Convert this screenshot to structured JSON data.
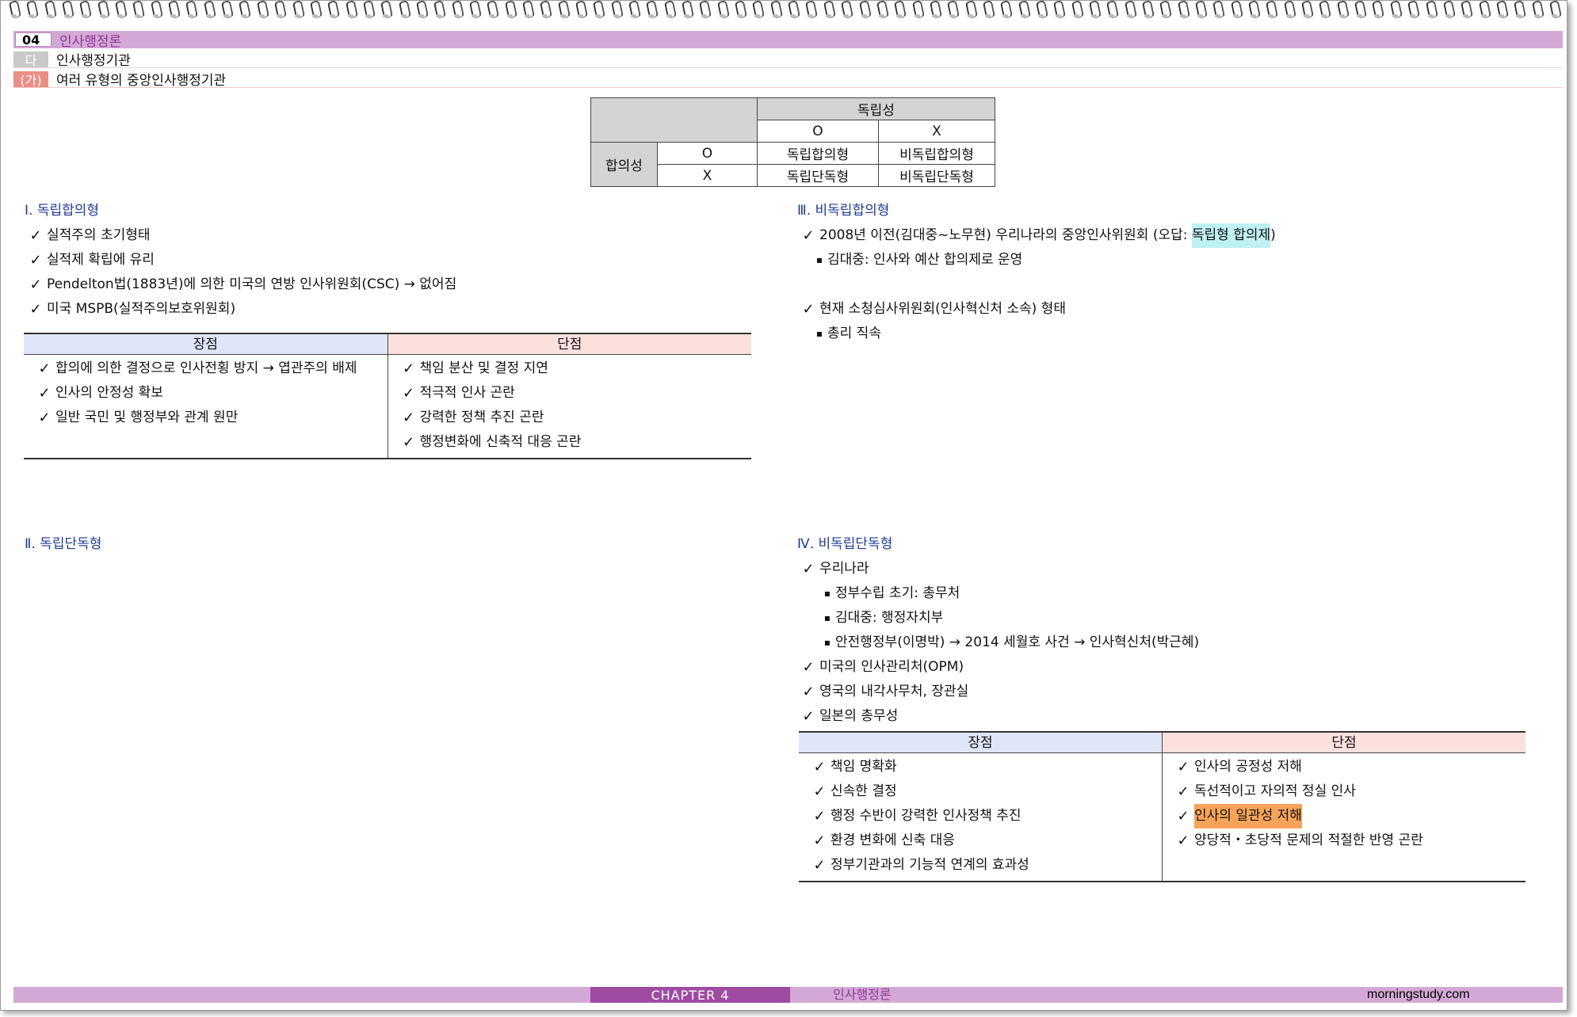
{
  "header": {
    "chapter_num": "04",
    "chapter_title": "인사행정론",
    "section_tag": "다",
    "section_title": "인사행정기관",
    "subsection_tag": "(가)",
    "subsection_title": "여러 유형의 중앙인사행정기관"
  },
  "matrix": {
    "col_group": "독립성",
    "col_o": "O",
    "col_x": "X",
    "row_group": "합의성",
    "row_o": "O",
    "row_x": "X",
    "cell_oo": "독립합의형",
    "cell_ox": "비독립합의형",
    "cell_xo": "독립단독형",
    "cell_xx": "비독립단독형"
  },
  "sec1": {
    "title": "Ⅰ. 독립합의형",
    "items": [
      "실적주의 초기형태",
      "실적제 확립에 유리",
      "Pendelton법(1883년)에 의한 미국의 연방 인사위원회(CSC)  → 없어짐",
      "미국 MSPB(실적주의보호위원회)"
    ],
    "pros_header": "장점",
    "cons_header": "단점",
    "pros": [
      "합의에 의한 결정으로 인사전횡 방지 → 엽관주의 배제",
      "인사의 안정성 확보",
      "일반 국민 및 행정부와 관계 원만"
    ],
    "cons": [
      "책임 분산 및 결정 지연",
      "적극적 인사 곤란",
      "강력한 정책 추진 곤란",
      "행정변화에 신축적 대응 곤란"
    ]
  },
  "sec2": {
    "title": "Ⅱ. 독립단독형"
  },
  "sec3": {
    "title": "Ⅲ. 비독립합의형",
    "item1_pre": "2008년 이전(김대중~노무현) 우리나라의 중앙인사위원회 (오답: ",
    "item1_hl": "독립형 합의제",
    "item1_post": ")",
    "item1_sub": "김대중: 인사와 예산 합의제로 운영",
    "item2": "현재 소청심사위원회(인사혁신처 소속) 형태",
    "item2_sub": "총리 직속"
  },
  "sec4": {
    "title": "Ⅳ. 비독립단독형",
    "item1": "우리나라",
    "item1_subs": [
      "정부수립 초기: 총무처",
      "김대중: 행정자치부",
      "안전행정부(이명박) → 2014 세월호 사건 → 인사혁신처(박근혜)"
    ],
    "item2": "미국의 인사관리처(OPM)",
    "item3": "영국의 내각사무처, 장관실",
    "item4": "일본의 총무성",
    "pros_header": "장점",
    "cons_header": "단점",
    "pros": [
      "책임 명확화",
      "신속한 결정",
      "행정 수반이 강력한 인사정책 추진",
      "환경 변화에 신축 대응",
      "정부기관과의 기능적 연계의 효과성"
    ],
    "cons": [
      "인사의 공정성 저해",
      "독선적이고 자의적 정실 인사",
      "인사의 일관성 저해",
      "양당적・초당적 문제의 적절한 반영 곤란"
    ]
  },
  "footer": {
    "chapter": "CHAPTER 4",
    "title": "인사행정론",
    "site": "morningstudy.com"
  },
  "icons": {
    "check": "✓",
    "bullet": "▪"
  },
  "colors": {
    "header_band": "#d4a8d6",
    "accent_purple": "#9e4ba1",
    "section_title_blue": "#1f3c95",
    "highlight_cyan": "#bff0f2",
    "highlight_orange": "#f7a45a"
  }
}
